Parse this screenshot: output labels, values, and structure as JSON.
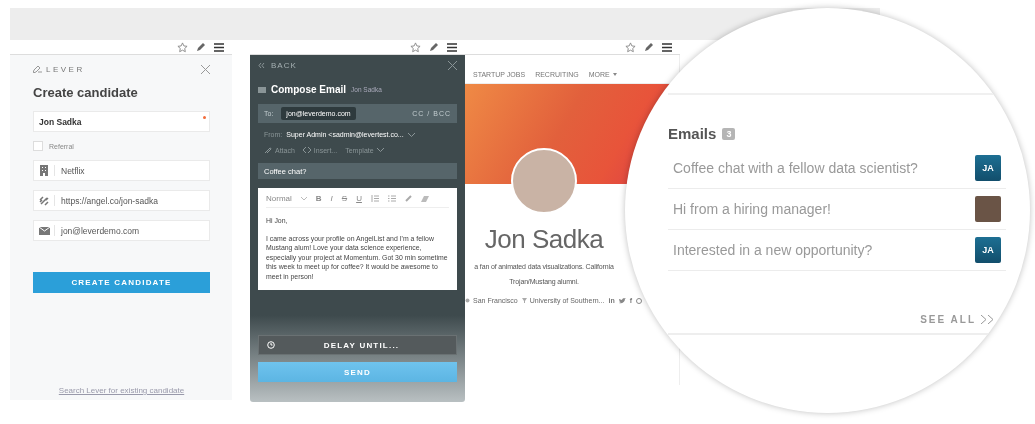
{
  "candidate_panel": {
    "logo": "LEVER",
    "title": "Create candidate",
    "fields": [
      {
        "kind": "name",
        "value": "Jon Sadka",
        "required": true
      },
      {
        "kind": "company",
        "value": "Netflix",
        "required": false
      },
      {
        "kind": "link",
        "value": "https://angel.co/jon-sadka",
        "required": false
      },
      {
        "kind": "email",
        "value": "jon@leverdemo.com",
        "required": false
      }
    ],
    "referral": {
      "label": "Referral",
      "checked": false
    },
    "submit": "CREATE CANDIDATE",
    "footer_link": "Search Lever for existing candidate"
  },
  "compose": {
    "back": "BACK",
    "title": "Compose Email",
    "candidate": "Jon Sadka",
    "to_label": "To:",
    "to_chip": "jon@leverdemo.com",
    "cc_bcc": "CC / BCC",
    "from_label": "From:",
    "from_value": "Super Admin <sadmin@levertest.co...",
    "actions": [
      {
        "kind": "attach",
        "label": "Attach"
      },
      {
        "kind": "insert",
        "label": "Insert..."
      },
      {
        "kind": "template",
        "label": "Template"
      }
    ],
    "subject": "Coffee chat?",
    "format": "Normal",
    "format_buttons": [
      "B",
      "I",
      "S",
      "U"
    ],
    "body": [
      "Hi Jon,",
      "I came across your profile on AngelList and I'm a fellow Mustang alum! Love your data science experience, especially your project at Momentum. Got 30 min sometime this week to meet up for coffee? It would be awesome to meet in person!"
    ],
    "delay": "DELAY UNTIL...",
    "send": "SEND"
  },
  "profile": {
    "nav": [
      "STARTUP JOBS",
      "RECRUITING",
      "MORE"
    ],
    "name": "Jon Sadka",
    "bio_lines": [
      "a fan of animated data visualizations. California",
      "Trojan/Mustang alumni."
    ],
    "meta": [
      {
        "kind": "location",
        "label": "San Francisco"
      },
      {
        "kind": "school",
        "label": "University of Southern..."
      }
    ],
    "social": [
      {
        "kind": "text",
        "label": "in"
      },
      {
        "kind": "bird"
      },
      {
        "kind": "text",
        "label": "f"
      },
      {
        "kind": "ball"
      }
    ]
  },
  "emails": {
    "title": "Emails",
    "count": "3",
    "items": [
      {
        "subject": "Coffee chat with a fellow data scientist?",
        "sender": {
          "kind": "initials",
          "text": "JA"
        }
      },
      {
        "subject": "Hi from a hiring manager!",
        "sender": {
          "kind": "photo"
        }
      },
      {
        "subject": "Interested in a new opportunity?",
        "sender": {
          "kind": "initials",
          "text": "JA"
        }
      }
    ],
    "see_all": "SEE ALL"
  }
}
